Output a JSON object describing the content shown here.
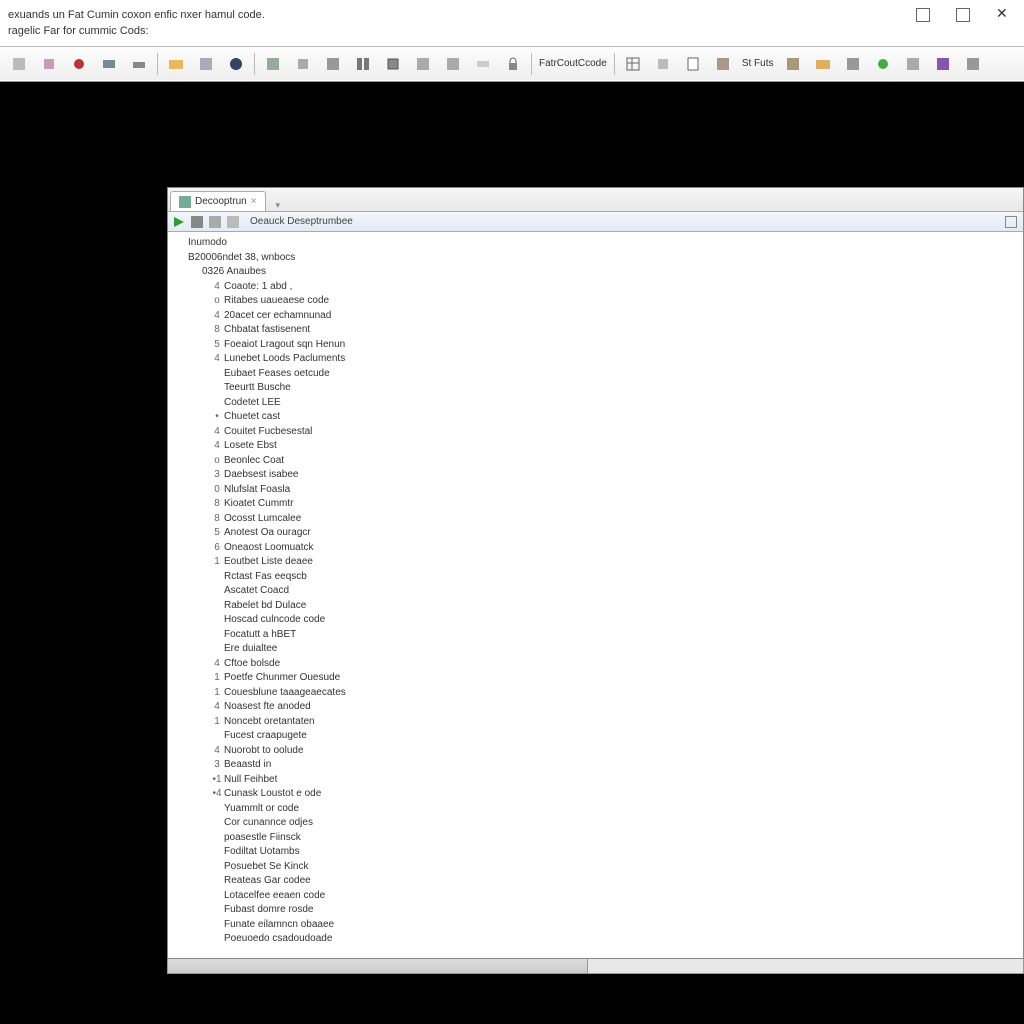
{
  "title": {
    "line1": "exuands un Fat Cumin coxon enfic nxer hamul code.",
    "line2": "ragelic Far for cummic Cods:"
  },
  "toolbar": {
    "label": "St Futs",
    "code_label": "FatrCoutCcode"
  },
  "panel": {
    "tab_label": "Decooptrun",
    "toolbar_label": "Oeauck Deseptrumbee"
  },
  "tree": {
    "header1": "Inumodo",
    "header2": "B20006ndet 38, wnbocs",
    "header3": "0326 Anaubes",
    "items": [
      {
        "exp": "4",
        "label": "Coaote:   1  abd ,"
      },
      {
        "exp": "o",
        "label": "Ritabes uaueaese  code"
      },
      {
        "exp": "4",
        "label": "20acet cer echamnunad"
      },
      {
        "exp": "8",
        "label": "Chbatat fastisenent"
      },
      {
        "exp": "5",
        "label": "Foeaiot Lragout sqn Henun"
      },
      {
        "exp": "4",
        "label": "Lunebet Loods Pacluments"
      },
      {
        "exp": "",
        "label": "Eubaet Feases oetcude"
      },
      {
        "exp": "",
        "label": "Teeurtt Busche"
      },
      {
        "exp": "",
        "label": "Codetet LEE"
      },
      {
        "exp": "•",
        "label": "Chuetet cast"
      },
      {
        "exp": "4",
        "label": "Couitet Fucbesestal"
      },
      {
        "exp": "4",
        "label": "Losete Ebst"
      },
      {
        "exp": "o",
        "label": "Beonlec Coat"
      },
      {
        "exp": "3",
        "label": "Daebsest isabee"
      },
      {
        "exp": "0",
        "label": "Nlufslat Foasla"
      },
      {
        "exp": "8",
        "label": "Kioatet Cummtr"
      },
      {
        "exp": "8",
        "label": "Ocosst Lumcalee"
      },
      {
        "exp": "5",
        "label": "Anotest Oa ouragcr"
      },
      {
        "exp": "6",
        "label": "Oneaost Loomuatck"
      },
      {
        "exp": "1",
        "label": "Eoutbet Liste deaee"
      },
      {
        "exp": "",
        "label": "Rctast Fas eeqscb"
      },
      {
        "exp": "",
        "label": "Ascatet Coacd"
      },
      {
        "exp": "",
        "label": "Rabelet  bd Dulace"
      },
      {
        "exp": "",
        "label": "Hoscad  culncode code"
      },
      {
        "exp": "",
        "label": "Focatutt a  hBET"
      },
      {
        "exp": "",
        "label": "Ere duialtee"
      },
      {
        "exp": "4",
        "label": "Cftoe bolsde"
      },
      {
        "exp": "1",
        "label": "Poetfe Chunmer Ouesude"
      },
      {
        "exp": "1",
        "label": "Couesblune taaageaecates"
      },
      {
        "exp": "4",
        "label": "Noasest fte anoded"
      },
      {
        "exp": "1",
        "label": "Noncebt oretantaten"
      },
      {
        "exp": "",
        "label": "Fucest craapugete"
      },
      {
        "exp": "4",
        "label": "Nuorobt  to oolude"
      },
      {
        "exp": "3",
        "label": "Beaastd  in"
      },
      {
        "exp": "•1",
        "label": "Null Feihbet"
      },
      {
        "exp": "•4",
        "label": "Cunask Loustot e  ode"
      },
      {
        "exp": "",
        "label": "Yuammlt or code"
      },
      {
        "exp": "",
        "label": "Cor cunannce odjes"
      },
      {
        "exp": "",
        "label": "poasestle Fiinsck"
      },
      {
        "exp": "",
        "label": "Fodiltat Uotambs"
      },
      {
        "exp": "",
        "label": "Posuebet Se Kinck"
      },
      {
        "exp": "",
        "label": "Reateas Gar codee"
      },
      {
        "exp": "",
        "label": "Lotacelfee eeaen  code"
      },
      {
        "exp": "",
        "label": "Fubast domre  rosde"
      },
      {
        "exp": "",
        "label": "Funate eilamncn obaaee"
      },
      {
        "exp": "",
        "label": "Poeuoedo csadoudoade"
      }
    ]
  }
}
